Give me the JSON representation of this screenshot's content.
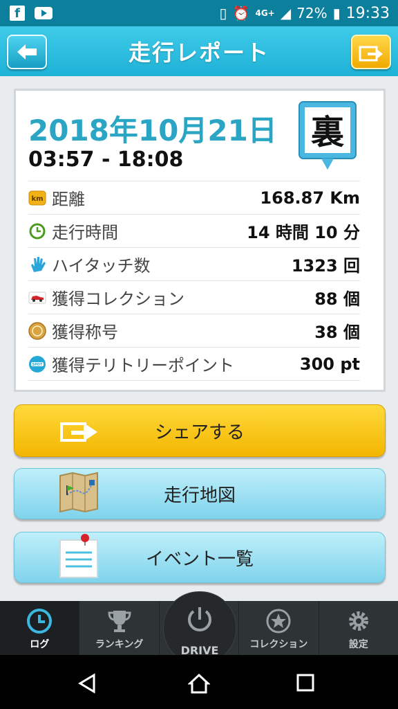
{
  "status_bar": {
    "network": "4G+",
    "battery": "72%",
    "time": "19:33"
  },
  "header": {
    "title": "走行レポート"
  },
  "report": {
    "date": "2018年10月21日",
    "time_range": "03:57 - 18:08",
    "badge_char": "裏",
    "rows": [
      {
        "icon": "km-icon",
        "label": "距離",
        "value": "168.87 Km"
      },
      {
        "icon": "clock-icon",
        "label": "走行時間",
        "value": "14 時間 10 分"
      },
      {
        "icon": "high-five-icon",
        "label": "ハイタッチ数",
        "value": "1323 回"
      },
      {
        "icon": "car-icon",
        "label": "獲得コレクション",
        "value": "88 個"
      },
      {
        "icon": "medal-icon",
        "label": "獲得称号",
        "value": "38 個"
      },
      {
        "icon": "spot-icon",
        "label": "獲得テリトリーポイント",
        "value": "300 pt"
      }
    ]
  },
  "buttons": {
    "share": "シェアする",
    "map": "走行地図",
    "events": "イベント一覧"
  },
  "tabs": {
    "log": "ログ",
    "ranking": "ランキング",
    "drive": "DRIVE",
    "collection": "コレクション",
    "settings": "設定"
  },
  "colors": {
    "accent": "#1eb1d6",
    "date": "#2aa5c3",
    "share_button": "#f3b600",
    "tab_bar": "#2e3336"
  }
}
